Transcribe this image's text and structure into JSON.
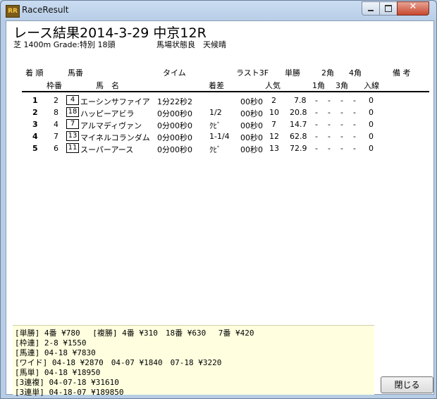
{
  "window": {
    "title": "RaceResult",
    "icon": "app-icon",
    "icon_text": "RR"
  },
  "race": {
    "title": "レース結果2014-3-29 中京12R",
    "subtitle": "芝 1400m Grade:特別 18頭",
    "conditions": "馬場状態良　天候晴"
  },
  "headers": {
    "place": "着 順",
    "horse_no": "馬番",
    "time": "タイム",
    "last3f": "ラスト3F",
    "win": "単勝",
    "corner2": "2角",
    "corner4": "4角",
    "remarks": "備 考",
    "frame": "枠番",
    "horse_name": "馬　名",
    "margin": "着差",
    "popularity": "人気",
    "corner1": "1角",
    "corner3": "3角",
    "finish": "入線"
  },
  "results": [
    {
      "place": "1",
      "frame": "2",
      "horse_no": "4",
      "name": "エーシンサファイア",
      "time": "1分22秒2",
      "margin": "",
      "last3f": "00秒0",
      "popularity": "2",
      "odds": "7.8",
      "c1": "-",
      "c2": "-",
      "c3": "-",
      "c4": "-",
      "finish": "0"
    },
    {
      "place": "2",
      "frame": "8",
      "horse_no": "18",
      "name": "ハッピーアビラ",
      "time": "0分00秒0",
      "margin": "1/2",
      "last3f": "00秒0",
      "popularity": "10",
      "odds": "20.8",
      "c1": "-",
      "c2": "-",
      "c3": "-",
      "c4": "-",
      "finish": "0"
    },
    {
      "place": "3",
      "frame": "4",
      "horse_no": "7",
      "name": "アルマディヴァン",
      "time": "0分00秒0",
      "margin": "ｸﾋﾞ",
      "last3f": "00秒0",
      "popularity": "7",
      "odds": "14.7",
      "c1": "-",
      "c2": "-",
      "c3": "-",
      "c4": "-",
      "finish": "0"
    },
    {
      "place": "4",
      "frame": "7",
      "horse_no": "13",
      "name": "マイネルコランダム",
      "time": "0分00秒0",
      "margin": "1-1/4",
      "last3f": "00秒0",
      "popularity": "12",
      "odds": "62.8",
      "c1": "-",
      "c2": "-",
      "c3": "-",
      "c4": "-",
      "finish": "0"
    },
    {
      "place": "5",
      "frame": "6",
      "horse_no": "11",
      "name": "スーパーアース",
      "time": "0分00秒0",
      "margin": "ｸﾋﾞ",
      "last3f": "00秒0",
      "popularity": "13",
      "odds": "72.9",
      "c1": "-",
      "c2": "-",
      "c3": "-",
      "c4": "-",
      "finish": "0"
    }
  ],
  "payouts": [
    "[単勝] 4番 ¥780　 [複勝] 4番 ¥310　18番 ¥630　 7番 ¥420",
    "[枠連] 2-8 ¥1550",
    "[馬連] 04-18 ¥7830",
    "[ワイド] 04-18 ¥2870　04-07 ¥1840　07-18 ¥3220",
    "[馬単] 04-18 ¥18950",
    "[3連複] 04-07-18 ¥31610",
    "[3連単] 04-18-07 ¥189850"
  ],
  "buttons": {
    "close_label": "閉じる"
  },
  "colors": {
    "payout_background": "#ffffe0",
    "close_button_accent": "#c8492e"
  }
}
